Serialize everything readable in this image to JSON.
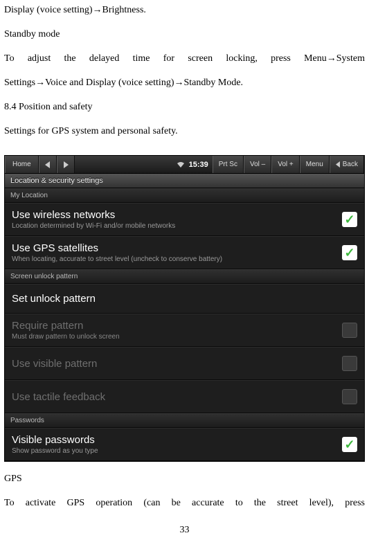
{
  "doc": {
    "p1": "Display (voice setting)→Brightness.",
    "p2": "Standby mode",
    "p3": "To adjust the delayed time for screen locking, press Menu→System",
    "p4": "Settings→Voice and Display (voice setting)→Standby Mode.",
    "p5": "8.4 Position and safety",
    "p6": "Settings for GPS system and personal safety.",
    "p7": "GPS",
    "p8": "To activate GPS operation (can be accurate to the street level), press",
    "page_num": "33"
  },
  "topbar": {
    "home": "Home",
    "prtsc": "Prt Sc",
    "volminus": "Vol –",
    "volplus": "Vol +",
    "menu": "Menu",
    "back": "Back",
    "clock": "15:39"
  },
  "titlebar": "Location & security settings",
  "sections": {
    "my_location": "My Location",
    "screen_unlock": "Screen unlock pattern",
    "passwords": "Passwords"
  },
  "settings": {
    "wireless": {
      "title": "Use wireless networks",
      "sub": "Location determined by Wi-Fi and/or mobile networks"
    },
    "gps": {
      "title": "Use GPS satellites",
      "sub": "When locating, accurate to street level (uncheck to conserve battery)"
    },
    "unlock": {
      "title": "Set unlock pattern"
    },
    "require": {
      "title": "Require pattern",
      "sub": "Must draw pattern to unlock screen"
    },
    "visible": {
      "title": "Use visible pattern"
    },
    "tactile": {
      "title": "Use tactile feedback"
    },
    "vispw": {
      "title": "Visible passwords",
      "sub": "Show password as you type"
    }
  }
}
